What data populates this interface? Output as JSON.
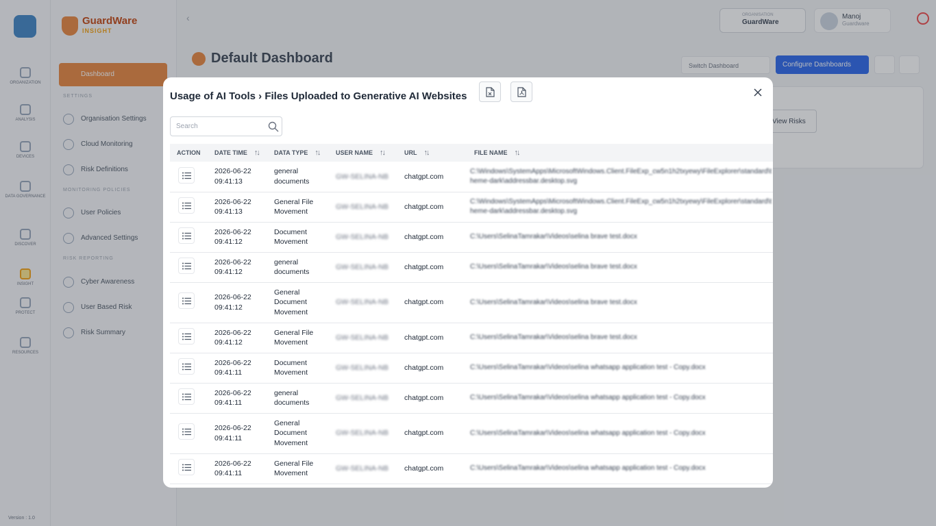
{
  "rail": {
    "items": [
      "ORGANIZATION",
      "ANALYSIS",
      "DEVICES",
      "DATA GOVERNANCE",
      "DISCOVER",
      "INSIGHT",
      "PROTECT",
      "RESOURCES"
    ],
    "version": "Version : 1.0"
  },
  "sidenav": {
    "brand_name": "GuardWare",
    "brand_sub": "INSIGHT",
    "active_item": "Dashboard",
    "section_settings": "SETTINGS",
    "settings_items": [
      "Organisation Settings",
      "Cloud Monitoring",
      "Risk Definitions"
    ],
    "section_policies": "MONITORING POLICIES",
    "policy_items": [
      "User Policies",
      "Advanced Settings"
    ],
    "section_reporting": "RISK REPORTING",
    "reporting_items": [
      "Cyber Awareness",
      "User Based Risk",
      "Risk Summary"
    ]
  },
  "topbar": {
    "org_label": "ORGANISATION",
    "org_value": "GuardWare",
    "user_name": "Manoj",
    "user_role": "Guardware"
  },
  "dashboard": {
    "title": "Default Dashboard",
    "switch_label": "Switch Dashboard",
    "configure_label": "Configure Dashboards",
    "risk_button": "View Risks"
  },
  "modal": {
    "title": "Usage of AI Tools  ›  Files Uploaded to Generative AI Websites",
    "search_placeholder": "Search",
    "columns": [
      "ACTION",
      "DATE TIME",
      "DATA TYPE",
      "USER NAME",
      "URL",
      "FILE NAME"
    ],
    "rows": [
      {
        "date": "2026-06-22",
        "time": "09:41:13",
        "type": "general documents",
        "user": "GW-SELINA-NB",
        "url": "chatgpt.com",
        "file": "C:\\Windows\\SystemApps\\MicrosoftWindows.Client.FileExp_cw5n1h2txyewy\\FileExplorer\\standard\\theme-dark\\addressbar.desktop.svg"
      },
      {
        "date": "2026-06-22",
        "time": "09:41:13",
        "type": "General File Movement",
        "user": "GW-SELINA-NB",
        "url": "chatgpt.com",
        "file": "C:\\Windows\\SystemApps\\MicrosoftWindows.Client.FileExp_cw5n1h2txyewy\\FileExplorer\\standard\\theme-dark\\addressbar.desktop.svg"
      },
      {
        "date": "2026-06-22",
        "time": "09:41:12",
        "type": "Document Movement",
        "user": "GW-SELINA-NB",
        "url": "chatgpt.com",
        "file": "C:\\Users\\SelinaTamrakar\\Videos\\selina brave test.docx"
      },
      {
        "date": "2026-06-22",
        "time": "09:41:12",
        "type": "general documents",
        "user": "GW-SELINA-NB",
        "url": "chatgpt.com",
        "file": "C:\\Users\\SelinaTamrakar\\Videos\\selina brave test.docx"
      },
      {
        "date": "2026-06-22",
        "time": "09:41:12",
        "type": "General Document Movement",
        "user": "GW-SELINA-NB",
        "url": "chatgpt.com",
        "file": "C:\\Users\\SelinaTamrakar\\Videos\\selina brave test.docx"
      },
      {
        "date": "2026-06-22",
        "time": "09:41:12",
        "type": "General File Movement",
        "user": "GW-SELINA-NB",
        "url": "chatgpt.com",
        "file": "C:\\Users\\SelinaTamrakar\\Videos\\selina brave test.docx"
      },
      {
        "date": "2026-06-22",
        "time": "09:41:11",
        "type": "Document Movement",
        "user": "GW-SELINA-NB",
        "url": "chatgpt.com",
        "file": "C:\\Users\\SelinaTamrakar\\Videos\\selina whatsapp application test - Copy.docx"
      },
      {
        "date": "2026-06-22",
        "time": "09:41:11",
        "type": "general documents",
        "user": "GW-SELINA-NB",
        "url": "chatgpt.com",
        "file": "C:\\Users\\SelinaTamrakar\\Videos\\selina whatsapp application test - Copy.docx"
      },
      {
        "date": "2026-06-22",
        "time": "09:41:11",
        "type": "General Document Movement",
        "user": "GW-SELINA-NB",
        "url": "chatgpt.com",
        "file": "C:\\Users\\SelinaTamrakar\\Videos\\selina whatsapp application test - Copy.docx"
      },
      {
        "date": "2026-06-22",
        "time": "09:41:11",
        "type": "General File Movement",
        "user": "GW-SELINA-NB",
        "url": "chatgpt.com",
        "file": "C:\\Users\\SelinaTamrakar\\Videos\\selina whatsapp application test - Copy.docx"
      }
    ]
  }
}
